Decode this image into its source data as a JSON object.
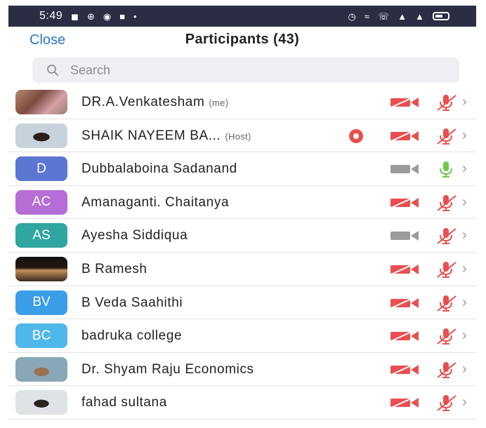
{
  "status_bar": {
    "time": "5:49",
    "left_icons": [
      "bold-n-icon",
      "grid-icon",
      "media-icon",
      "video-icon",
      "dot-icon"
    ],
    "right_icons": [
      "alarm-icon",
      "wifi-icon",
      "call-icon",
      "signal-icon",
      "signal-icon",
      "battery-icon"
    ]
  },
  "header": {
    "close_label": "Close",
    "title": "Participants (43)"
  },
  "search": {
    "placeholder": "Search"
  },
  "colors": {
    "accent_blue": "#2f76c4",
    "muted_red": "#e94f50",
    "active_green": "#6cc94a",
    "video_off_gray": "#9b9b9b"
  },
  "participants": [
    {
      "name": "DR.A.Venkatesham",
      "tag": "(me)",
      "avatar_text": "",
      "avatar_photo": "photo-1",
      "avatar_color": "",
      "video": "off-red",
      "mic": "muted",
      "recording": false
    },
    {
      "name": "SHAIK NAYEEM BA...",
      "tag": "(Host)",
      "avatar_text": "",
      "avatar_photo": "photo-2",
      "avatar_color": "",
      "video": "off-red",
      "mic": "muted",
      "recording": true
    },
    {
      "name": "Dubbalaboina Sadanand",
      "tag": "",
      "avatar_text": "D",
      "avatar_photo": "",
      "avatar_color": "#5b77d1",
      "video": "off-gray",
      "mic": "on",
      "recording": false
    },
    {
      "name": "Amanaganti. Chaitanya",
      "tag": "",
      "avatar_text": "AC",
      "avatar_photo": "",
      "avatar_color": "#b46ed6",
      "video": "off-red",
      "mic": "muted",
      "recording": false
    },
    {
      "name": "Ayesha Siddiqua",
      "tag": "",
      "avatar_text": "AS",
      "avatar_photo": "",
      "avatar_color": "#2fa6a0",
      "video": "off-gray",
      "mic": "muted",
      "recording": false
    },
    {
      "name": "B Ramesh",
      "tag": "",
      "avatar_text": "",
      "avatar_photo": "photo-3",
      "avatar_color": "",
      "video": "off-red",
      "mic": "muted",
      "recording": false
    },
    {
      "name": "B Veda Saahithi",
      "tag": "",
      "avatar_text": "BV",
      "avatar_photo": "",
      "avatar_color": "#3a9de8",
      "video": "off-red",
      "mic": "muted",
      "recording": false
    },
    {
      "name": "badruka college",
      "tag": "",
      "avatar_text": "BC",
      "avatar_photo": "",
      "avatar_color": "#4fb8ea",
      "video": "off-red",
      "mic": "muted",
      "recording": false
    },
    {
      "name": "Dr. Shyam Raju Economics",
      "tag": "",
      "avatar_text": "",
      "avatar_photo": "photo-4",
      "avatar_color": "",
      "video": "off-red",
      "mic": "muted",
      "recording": false
    },
    {
      "name": "fahad sultana",
      "tag": "",
      "avatar_text": "",
      "avatar_photo": "photo-5",
      "avatar_color": "",
      "video": "off-red",
      "mic": "muted",
      "recording": false
    }
  ]
}
